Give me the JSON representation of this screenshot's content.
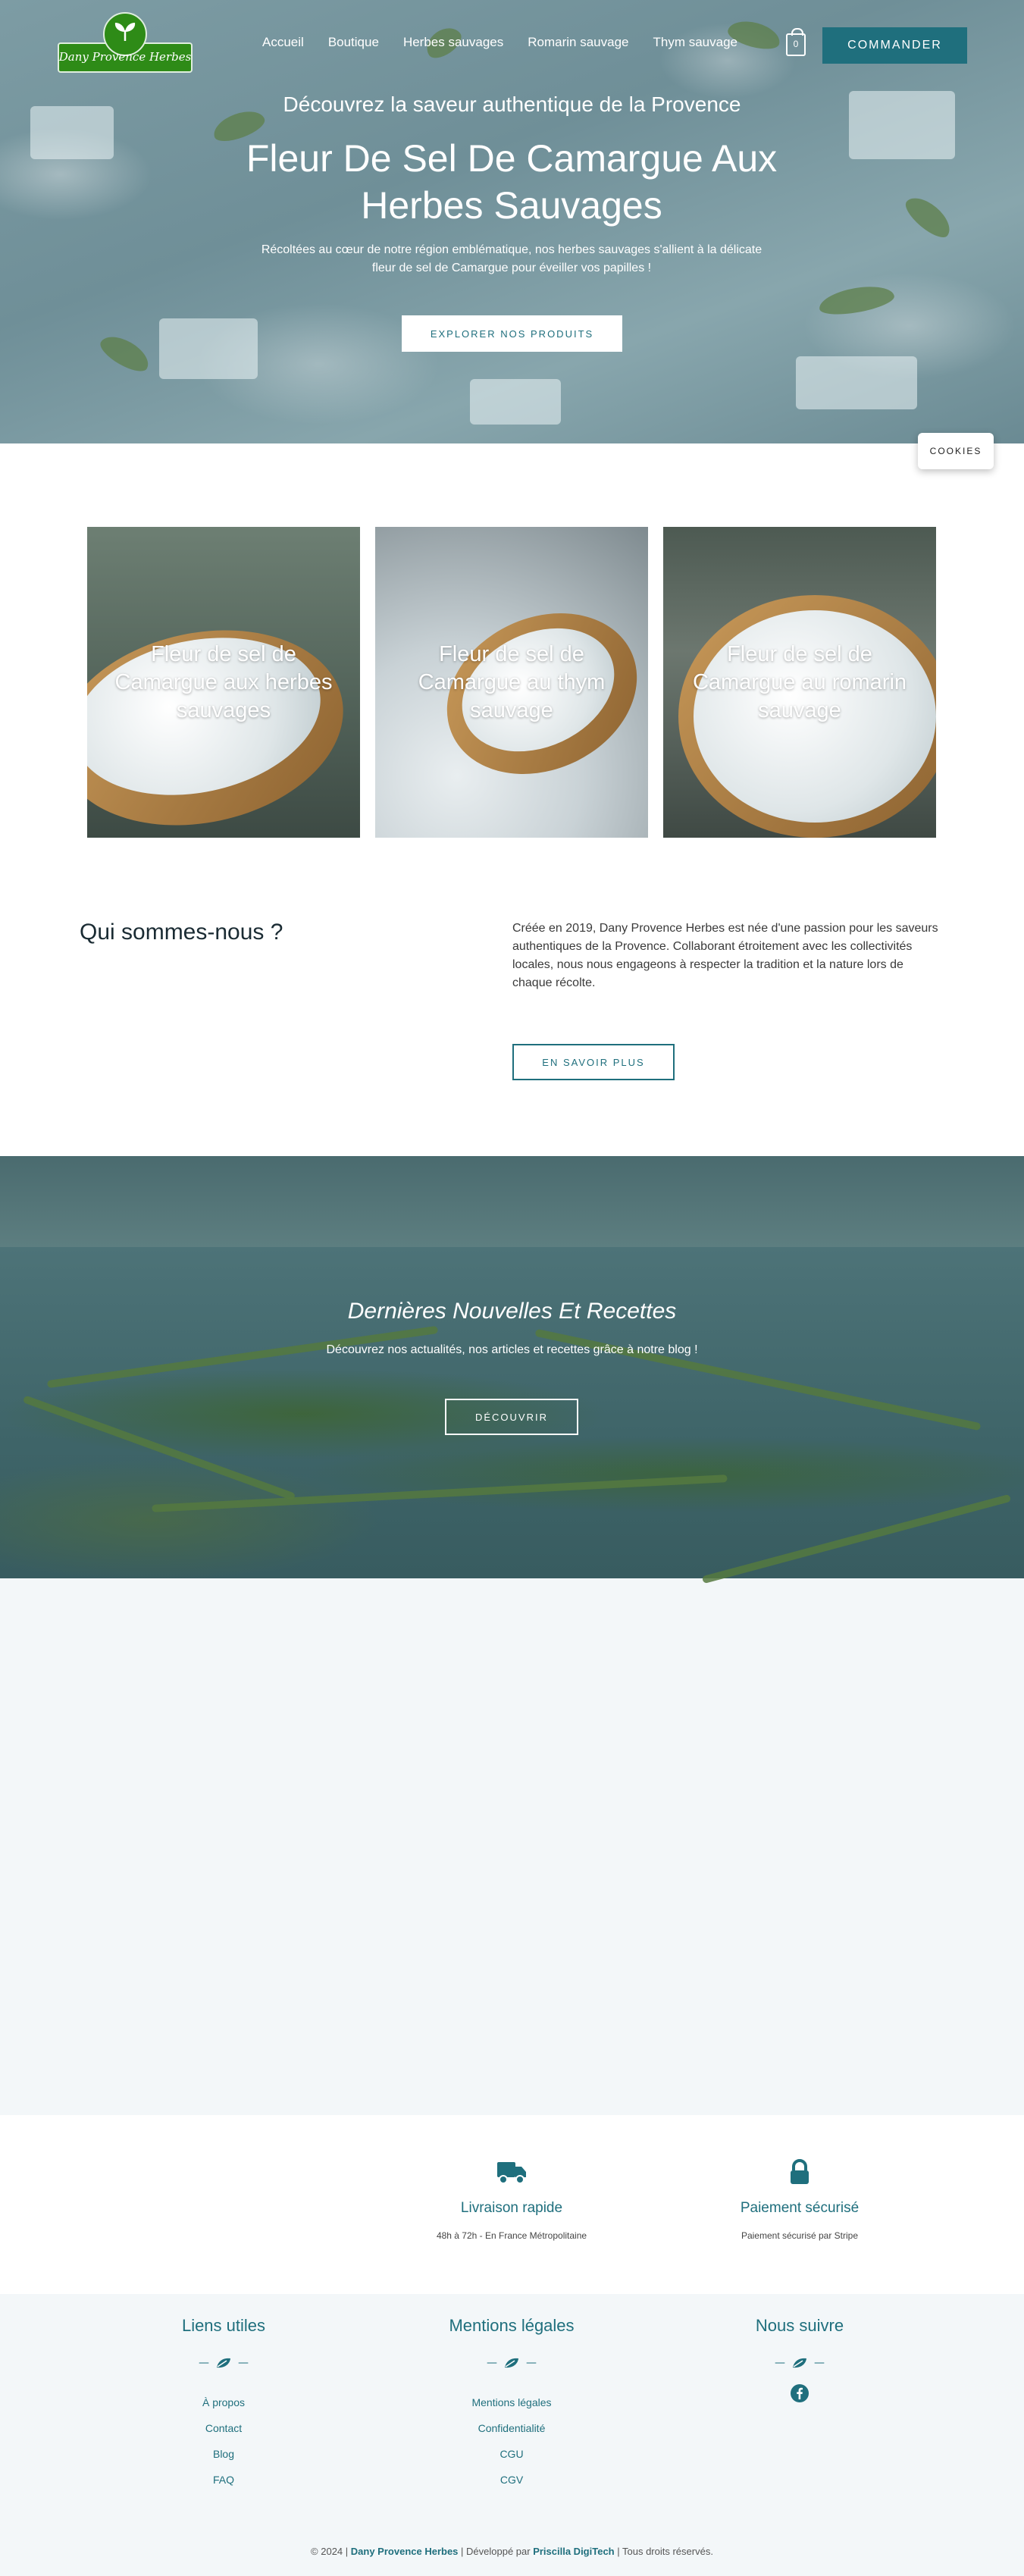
{
  "brand": {
    "logo_text": "Dany Provence Herbes"
  },
  "nav": {
    "items": [
      "Accueil",
      "Boutique",
      "Herbes sauvages",
      "Romarin sauvage",
      "Thym sauvage"
    ],
    "cart_count": "0",
    "order_label": "COMMANDER"
  },
  "hero": {
    "subtitle": "Découvrez la saveur authentique de la Provence",
    "title": "Fleur De Sel De Camargue Aux Herbes Sauvages",
    "text": "Récoltées au cœur de notre région emblématique, nos herbes sauvages s'allient à la délicate fleur de sel de Camargue pour éveiller vos papilles !",
    "button": "EXPLORER NOS PRODUITS"
  },
  "cookies_label": "COOKIES",
  "products": [
    {
      "label": "Fleur de sel de Camargue aux herbes sauvages"
    },
    {
      "label": "Fleur de sel de Camargue au thym sauvage"
    },
    {
      "label": "Fleur de sel de Camargue au romarin sauvage"
    }
  ],
  "about": {
    "title": "Qui sommes-nous ?",
    "text": "Créée en 2019, Dany Provence Herbes est née d'une passion pour les saveurs authentiques de la Provence. Collaborant étroitement avec les collectivités locales, nous nous engageons à respecter la tradition et la nature lors de chaque récolte.",
    "button": "EN SAVOIR PLUS"
  },
  "news": {
    "title": "Dernières Nouvelles Et Recettes",
    "text": "Découvrez nos actualités, nos articles et recettes grâce à notre blog !",
    "button": "DÉCOUVRIR"
  },
  "features": [
    {
      "icon": "truck-icon",
      "title": "Livraison rapide",
      "text": "48h à 72h - En France Métropolitaine"
    },
    {
      "icon": "lock-icon",
      "title": "Paiement sécurisé",
      "text": "Paiement sécurisé par Stripe"
    }
  ],
  "footer": {
    "useful": {
      "title": "Liens utiles",
      "links": [
        "À propos",
        "Contact",
        "Blog",
        "FAQ"
      ]
    },
    "legal": {
      "title": "Mentions légales",
      "links": [
        "Mentions légales",
        "Confidentialité",
        "CGU",
        "CGV"
      ]
    },
    "social": {
      "title": "Nous suivre",
      "icon": "facebook-icon"
    },
    "copyright_prefix": "© 2024 |",
    "brand": "Dany Provence Herbes",
    "dev_prefix": "| Développé par",
    "dev": "Priscilla DigiTech",
    "suffix": "| Tous droits réservés."
  },
  "colors": {
    "accent": "#1f6f7d",
    "logo_green": "#2e8b17",
    "page_bg": "#f3f7f9"
  }
}
